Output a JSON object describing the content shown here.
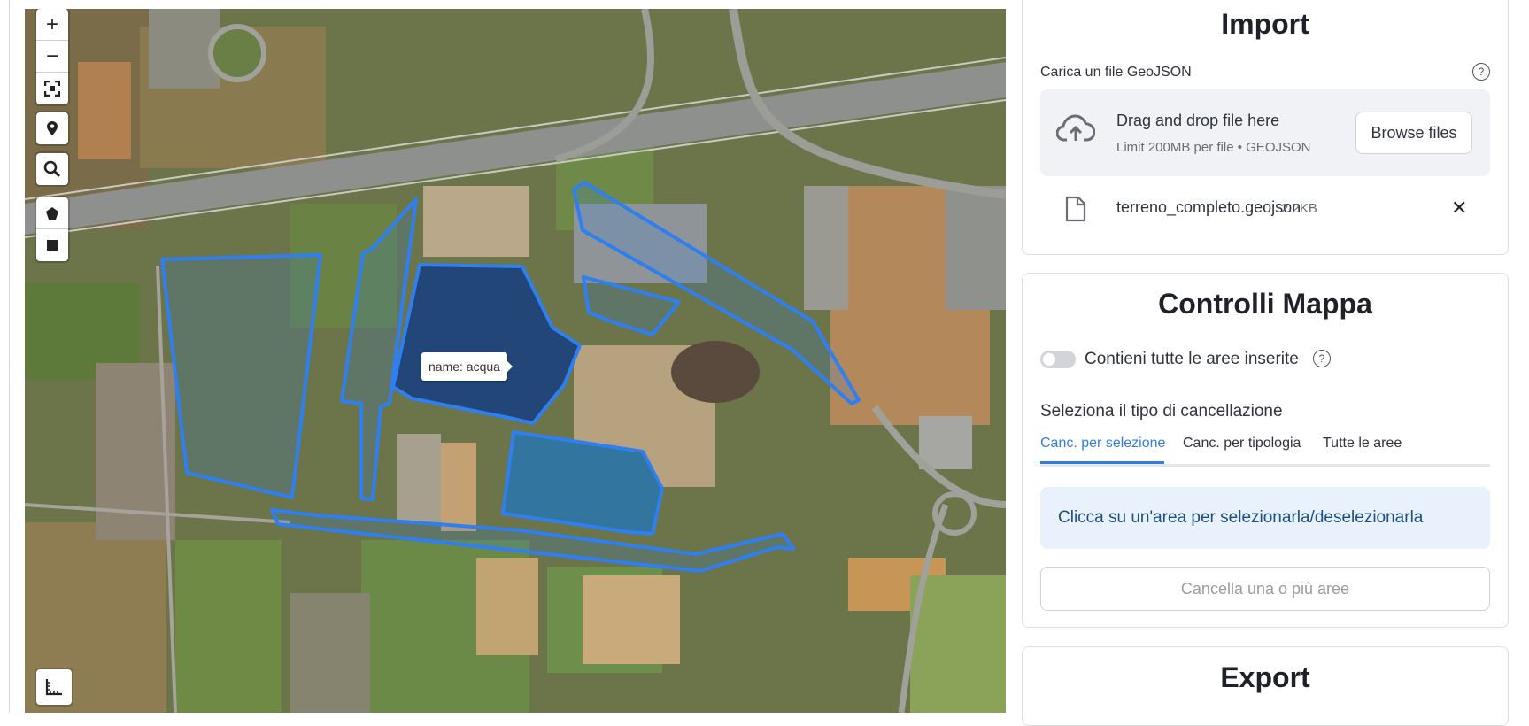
{
  "map": {
    "tooltip": "name: acqua",
    "controls": [
      "zoom-in",
      "zoom-out",
      "fullscreen",
      "locate",
      "search",
      "draw-polygon",
      "draw-rectangle"
    ],
    "zoom_in_symbol": "+",
    "zoom_out_symbol": "−",
    "polygon_color": "#2f7ff0"
  },
  "import": {
    "title": "Import",
    "upload_label": "Carica un file GeoJSON",
    "help_symbol": "?",
    "dropzone_title": "Drag and drop file here",
    "dropzone_limit": "Limit 200MB per file • GEOJSON",
    "browse_label": "Browse files",
    "file_name": "terreno_completo.geojson",
    "file_size": "2.2KB",
    "remove_symbol": "✕"
  },
  "controlli": {
    "title": "Controlli Mappa",
    "toggle_label": "Contieni tutte le aree inserite",
    "toggle_on": false,
    "select_label": "Seleziona il tipo di cancellazione",
    "tabs": [
      {
        "label": "Canc. per selezione",
        "active": true
      },
      {
        "label": "Canc. per tipologia",
        "active": false
      },
      {
        "label": "Tutte le aree",
        "active": false
      }
    ],
    "info_text": "Clicca su un'area per selezionarla/deselezionarla",
    "delete_button": "Cancella una o più aree"
  },
  "export": {
    "title": "Export"
  },
  "colors": {
    "accent": "#2f7fe3",
    "info_bg": "#e8f1fc",
    "info_text": "#1c4f82"
  }
}
